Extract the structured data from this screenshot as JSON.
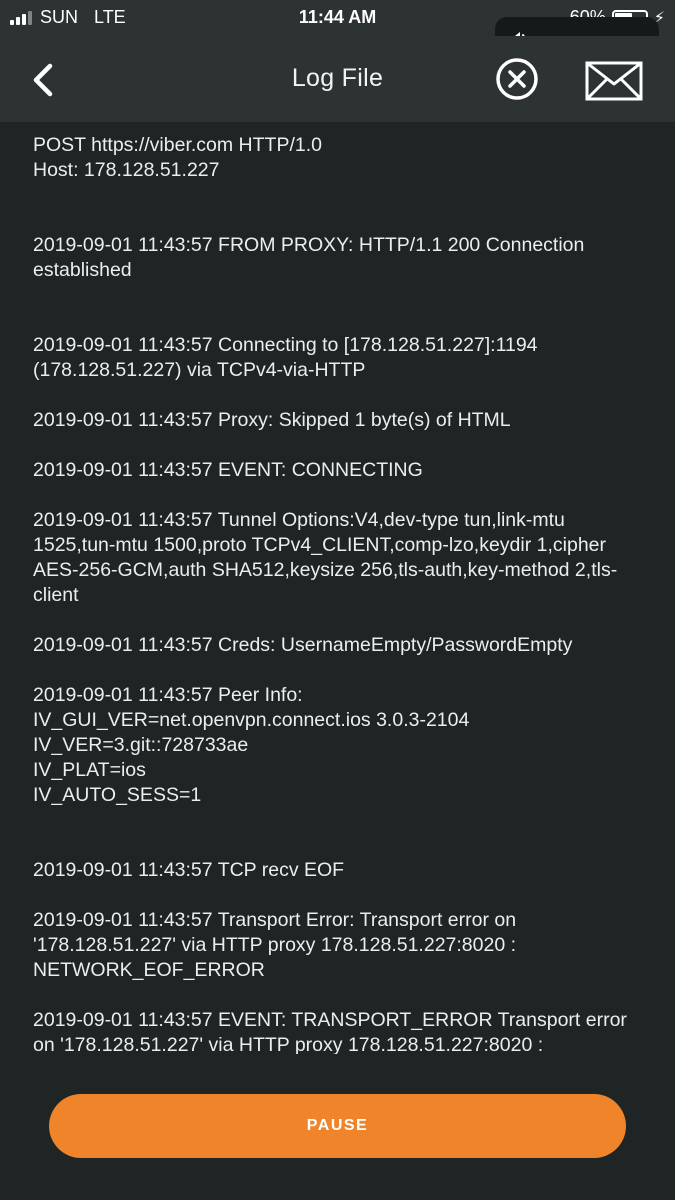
{
  "status_bar": {
    "carrier": "SUN",
    "network": "LTE",
    "time": "11:44 AM",
    "battery_text": "60%",
    "battery_level": 0.6
  },
  "volume": {
    "level": 0.9,
    "accent": "#8b55e5"
  },
  "header": {
    "title": "Log File"
  },
  "log": {
    "entries": [
      {
        "text": "POST https://viber.com HTTP/1.0\nHost: 178.128.51.227",
        "gap_after": 50
      },
      {
        "text": "2019-09-01 11:43:57 FROM PROXY: HTTP/1.1 200 Connection established",
        "gap_after": 50
      },
      {
        "text": "2019-09-01 11:43:57 Connecting to [178.128.51.227]:1194 (178.128.51.227) via TCPv4-via-HTTP",
        "gap_after": 25
      },
      {
        "text": "2019-09-01 11:43:57 Proxy: Skipped 1 byte(s) of HTML",
        "gap_after": 25
      },
      {
        "text": "2019-09-01 11:43:57 EVENT: CONNECTING",
        "gap_after": 25
      },
      {
        "text": "2019-09-01 11:43:57 Tunnel Options:V4,dev-type tun,link-mtu 1525,tun-mtu 1500,proto TCPv4_CLIENT,comp-lzo,keydir 1,cipher AES-256-GCM,auth SHA512,keysize 256,tls-auth,key-method 2,tls-client",
        "gap_after": 25
      },
      {
        "text": "2019-09-01 11:43:57 Creds: UsernameEmpty/PasswordEmpty",
        "gap_after": 25
      },
      {
        "text": "2019-09-01 11:43:57 Peer Info:\nIV_GUI_VER=net.openvpn.connect.ios 3.0.3-2104\nIV_VER=3.git::728733ae\nIV_PLAT=ios\nIV_AUTO_SESS=1",
        "gap_after": 50
      },
      {
        "text": "2019-09-01 11:43:57 TCP recv EOF",
        "gap_after": 25
      },
      {
        "text": "2019-09-01 11:43:57 Transport Error: Transport error on '178.128.51.227' via HTTP proxy 178.128.51.227:8020 : NETWORK_EOF_ERROR",
        "gap_after": 25
      },
      {
        "text": "2019-09-01 11:43:57 EVENT: TRANSPORT_ERROR Transport error on '178.128.51.227' via HTTP proxy 178.128.51.227:8020 :",
        "gap_after": 0
      }
    ]
  },
  "controls": {
    "pause_label": "PAUSE"
  },
  "colors": {
    "background": "#1f2424",
    "header_bg": "#2d3333",
    "accent": "#f0842a",
    "text": "#eceeee"
  },
  "icons": {
    "back": "chevron-left-icon",
    "clear": "close-circle-icon",
    "mail": "mail-icon",
    "volume": "speaker-icon",
    "charging": "bolt-icon"
  }
}
